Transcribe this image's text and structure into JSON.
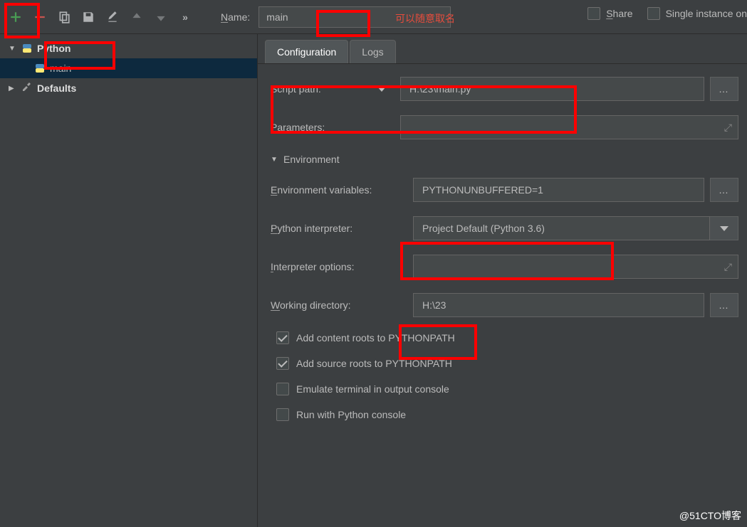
{
  "toolbar": {
    "name_label": "Name:",
    "name_value": "main",
    "rename_hint": "可以随意取名",
    "share_label": "Share",
    "single_instance_label": "Single instance on"
  },
  "sidebar": {
    "python_label": "Python",
    "main_label": "main",
    "defaults_label": "Defaults"
  },
  "tabs": {
    "configuration": "Configuration",
    "logs": "Logs"
  },
  "form": {
    "script_path_label": "Script path:",
    "script_path_value": "H:\\23\\main.py",
    "parameters_label": "Parameters:",
    "parameters_value": "",
    "environment_section": "Environment",
    "env_vars_label": "Environment variables:",
    "env_vars_value": "PYTHONUNBUFFERED=1",
    "interpreter_label": "Python interpreter:",
    "interpreter_value": "Project Default (Python 3.6)",
    "interpreter_options_label": "Interpreter options:",
    "interpreter_options_value": "",
    "working_dir_label": "Working directory:",
    "working_dir_value": "H:\\23",
    "add_content_roots": "Add content roots to PYTHONPATH",
    "add_source_roots": "Add source roots to PYTHONPATH",
    "emulate_terminal": "Emulate terminal in output console",
    "run_python_console": "Run with Python console"
  },
  "watermark": "@51CTO博客"
}
